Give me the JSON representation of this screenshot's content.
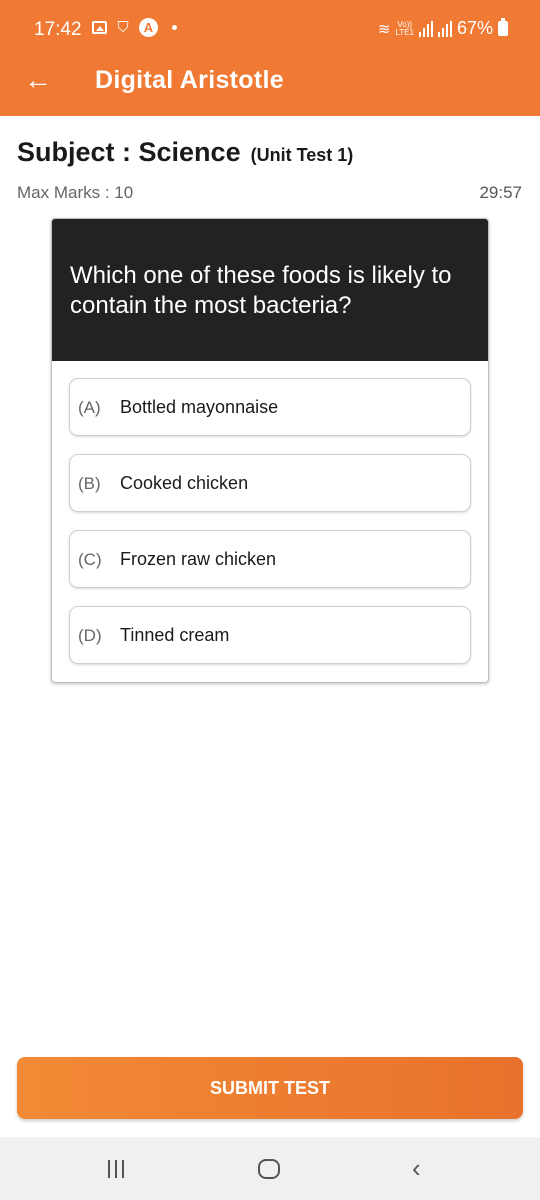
{
  "status_bar": {
    "time": "17:42",
    "battery": "67%",
    "network": "LTE1",
    "volte": "Vo))"
  },
  "app_bar": {
    "title": "Digital Aristotle",
    "back_icon": "arrow-left-icon"
  },
  "test": {
    "subject": "Subject : Science",
    "unit": "(Unit Test 1)",
    "max_marks": "Max Marks : 10",
    "timer": "29:57"
  },
  "question": {
    "text": "Which one of these foods is likely to contain the most bacteria?",
    "options": [
      {
        "letter": "(A)",
        "text": "Bottled mayonnaise"
      },
      {
        "letter": "(B)",
        "text": "Cooked chicken"
      },
      {
        "letter": "(C)",
        "text": "Frozen raw chicken"
      },
      {
        "letter": "(D)",
        "text": "Tinned cream"
      }
    ]
  },
  "actions": {
    "submit_label": "SUBMIT TEST"
  },
  "colors": {
    "brand": "#f07a33",
    "question_bg": "#222222"
  }
}
